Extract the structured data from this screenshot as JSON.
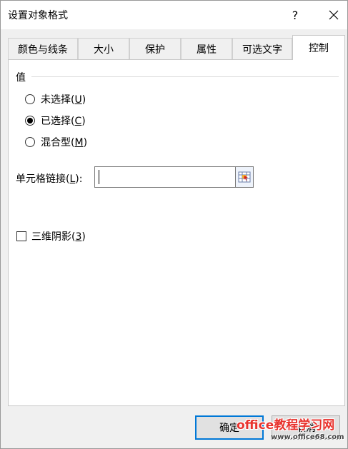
{
  "window": {
    "title": "设置对象格式",
    "help": "?",
    "close_icon": "close-icon"
  },
  "tabs": [
    {
      "label": "颜色与线条",
      "active": false
    },
    {
      "label": "大小",
      "active": false
    },
    {
      "label": "保护",
      "active": false
    },
    {
      "label": "属性",
      "active": false
    },
    {
      "label": "可选文字",
      "active": false
    },
    {
      "label": "控制",
      "active": true
    }
  ],
  "value_group": {
    "label": "值",
    "options": [
      {
        "text": "未选择(",
        "key": "U",
        "tail": ")",
        "selected": false
      },
      {
        "text": "已选择(",
        "key": "C",
        "tail": ")",
        "selected": true
      },
      {
        "text": "混合型(",
        "key": "M",
        "tail": ")",
        "selected": false
      }
    ]
  },
  "cell_link": {
    "label_pre": "单元格链接(",
    "key": "L",
    "label_post": "):",
    "value": ""
  },
  "shading": {
    "label_pre": "三维阴影(",
    "key": "3",
    "label_post": ")",
    "checked": false
  },
  "buttons": {
    "ok": "确定",
    "cancel": "取消"
  },
  "watermark": {
    "text": "office教程学习网",
    "url": "www.office68.com"
  }
}
